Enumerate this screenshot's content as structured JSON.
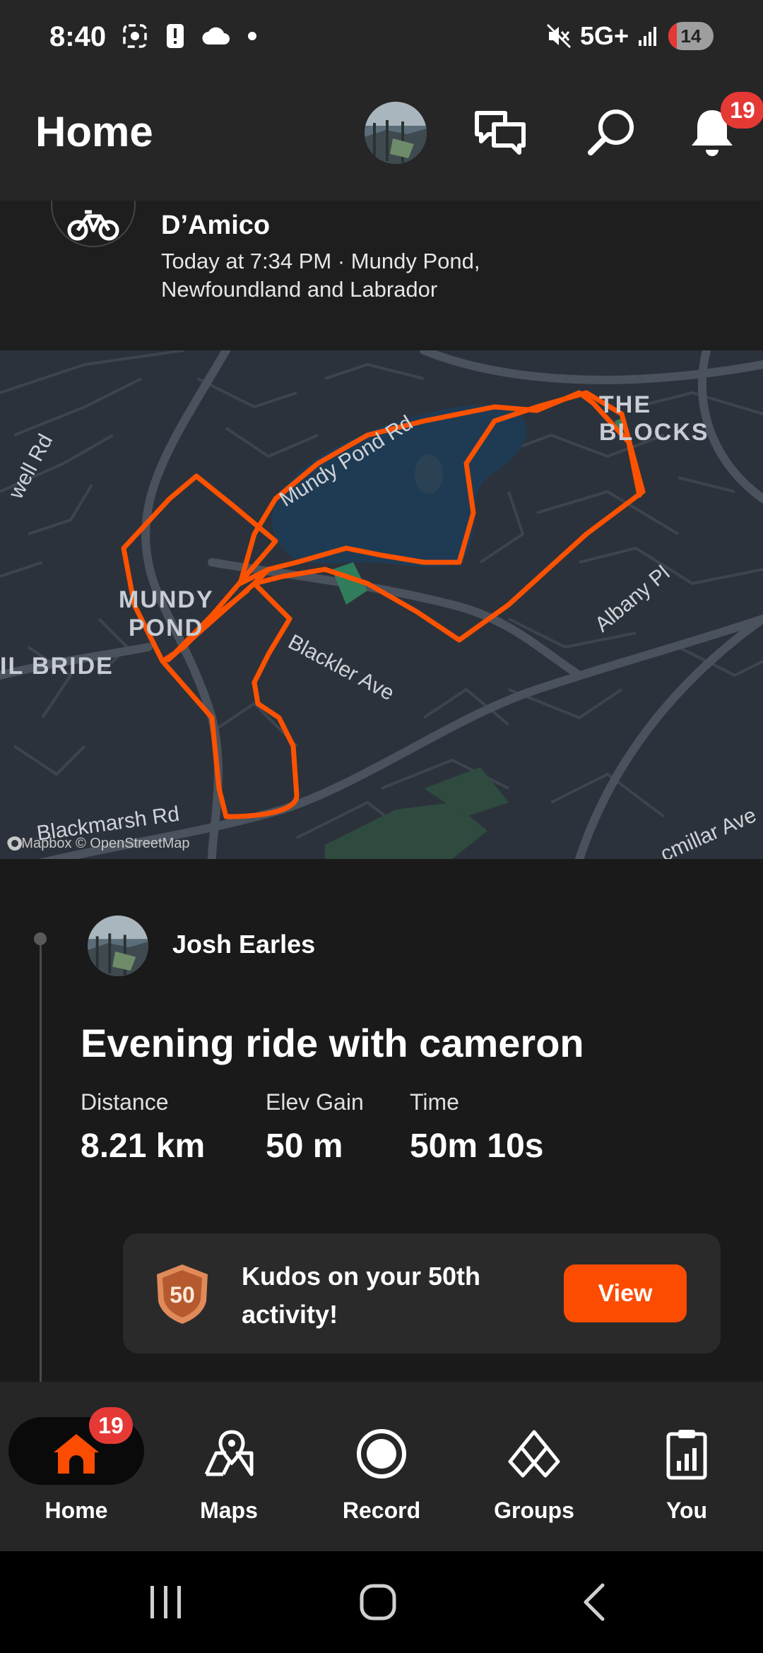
{
  "status_bar": {
    "time": "8:40",
    "network": "5G+",
    "battery": "14",
    "icons_left": [
      "screenshot-icon",
      "alert-icon",
      "cloud-icon",
      "dot-icon"
    ],
    "icons_right": [
      "mute-icon",
      "signal-icon",
      "battery-icon"
    ]
  },
  "header": {
    "title": "Home",
    "notifications_badge": "19"
  },
  "activity_top": {
    "athlete": "D’Amico",
    "meta": "Today at 7:34 PM · Mundy Pond, Newfoundland and Labrador"
  },
  "map": {
    "labels": {
      "the_blocks": "THE BLOCKS",
      "mundy": "MUNDY",
      "pond": "POND",
      "bride": "IL BRIDE",
      "mundy_pond_rd": "Mundy Pond Rd",
      "blackler_ave": "Blackler Ave",
      "albany_pl": "Albany Pl",
      "blackmarsh_rd": "Blackmarsh Rd",
      "well_rd": "well Rd",
      "macmillar_ave": "cmillar Ave"
    },
    "attribution": "© Mapbox © OpenStreetMap",
    "route_color": "#fc5200"
  },
  "activity": {
    "athlete": "Josh Earles",
    "title": "Evening ride with cameron",
    "stats": [
      {
        "label": "Distance",
        "value": "8.21 km"
      },
      {
        "label": "Elev Gain",
        "value": "50 m"
      },
      {
        "label": "Time",
        "value": "50m 10s"
      }
    ],
    "kudos": {
      "badge_number": "50",
      "text": "Kudos on your 50th activity!",
      "button": "View"
    }
  },
  "bottom_nav": {
    "items": [
      {
        "label": "Home",
        "badge": "19"
      },
      {
        "label": "Maps"
      },
      {
        "label": "Record"
      },
      {
        "label": "Groups"
      },
      {
        "label": "You"
      }
    ]
  },
  "colors": {
    "accent": "#fc4c02",
    "badge": "#e53935",
    "background": "#1a1a1a"
  }
}
